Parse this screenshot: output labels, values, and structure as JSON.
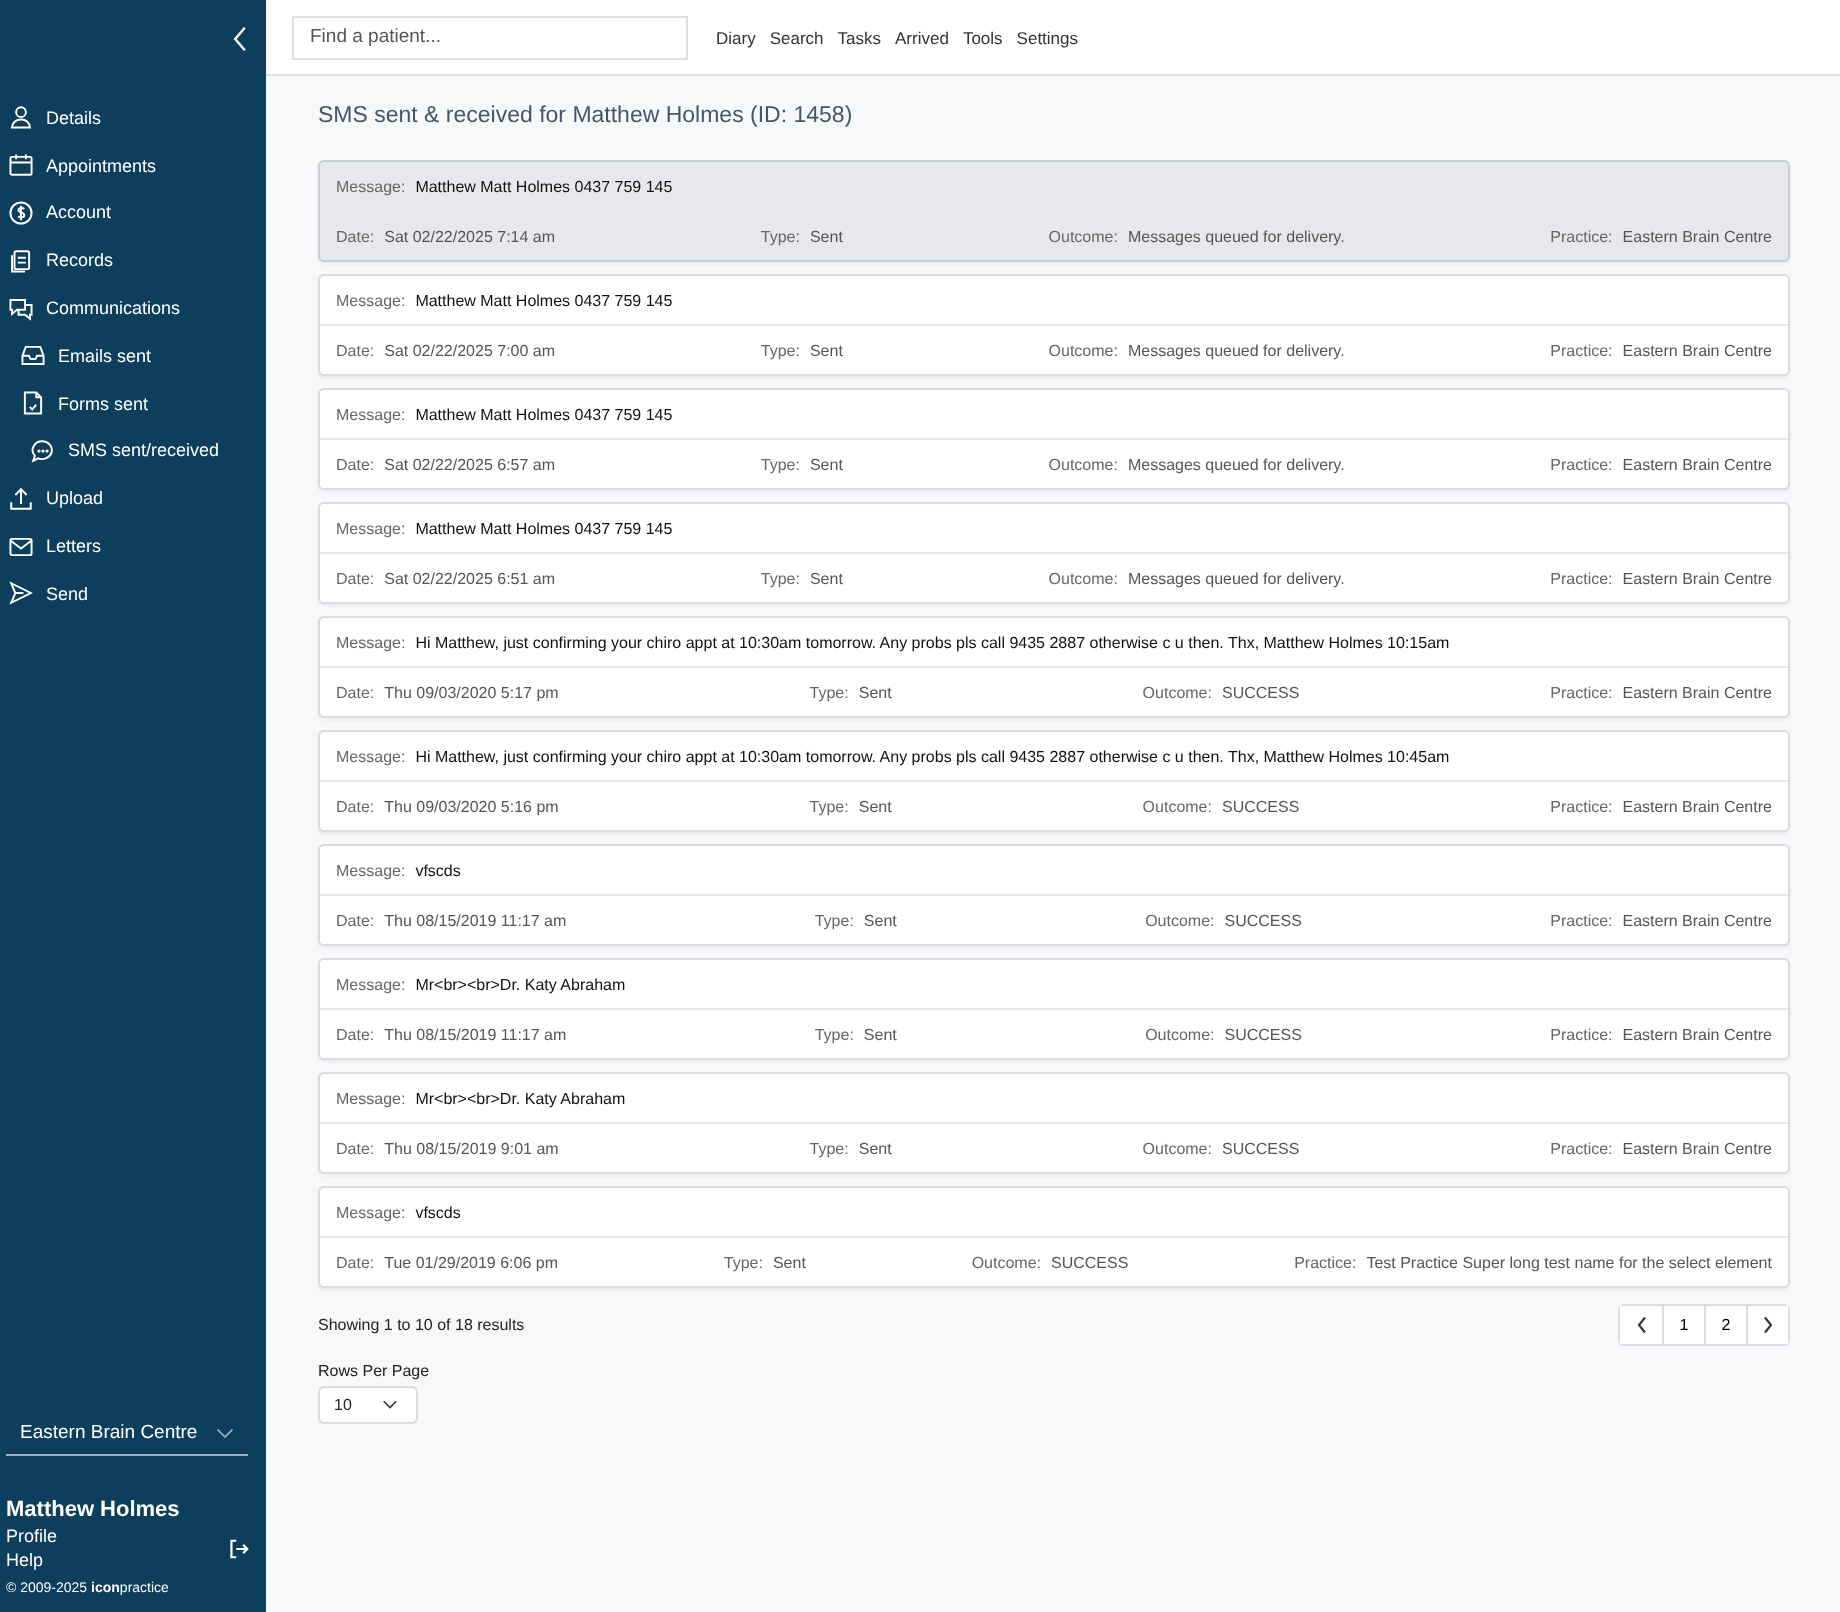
{
  "sidebar": {
    "items": [
      {
        "label": "Details"
      },
      {
        "label": "Appointments"
      },
      {
        "label": "Account"
      },
      {
        "label": "Records"
      },
      {
        "label": "Communications",
        "children": [
          {
            "label": "Emails sent"
          },
          {
            "label": "Forms sent"
          },
          {
            "label": "SMS sent/received"
          }
        ]
      },
      {
        "label": "Upload"
      },
      {
        "label": "Letters"
      },
      {
        "label": "Send"
      }
    ],
    "practice_select": {
      "value": "Eastern Brain Centre"
    },
    "user": {
      "name": "Matthew Holmes",
      "links": [
        "Profile",
        "Help"
      ]
    },
    "copyright": "© 2009-2025 **icon**practice"
  },
  "topbar": {
    "search": {
      "placeholder": "Find a patient..."
    },
    "menu": [
      "Diary",
      "Search",
      "Tasks",
      "Arrived",
      "Tools",
      "Settings"
    ]
  },
  "page_title": "SMS sent & received for Matthew Holmes (ID: 1458)",
  "messages": [
    {
      "selected": true,
      "message": {
        "label": "Message:",
        "value": "Matthew Matt Holmes 0437 759 145"
      },
      "fields": [
        {
          "label": "Date:",
          "value": "Sat 02/22/2025 7:14 am"
        },
        {
          "label": "Type:",
          "value": "Sent"
        },
        {
          "label": "Outcome:",
          "value": "Messages queued for delivery."
        },
        {
          "label": "Practice:",
          "value": "Eastern Brain Centre"
        }
      ]
    },
    {
      "selected": false,
      "message": {
        "label": "Message:",
        "value": "Matthew Matt Holmes 0437 759 145"
      },
      "fields": [
        {
          "label": "Date:",
          "value": "Sat 02/22/2025 7:00 am"
        },
        {
          "label": "Type:",
          "value": "Sent"
        },
        {
          "label": "Outcome:",
          "value": "Messages queued for delivery."
        },
        {
          "label": "Practice:",
          "value": "Eastern Brain Centre"
        }
      ]
    },
    {
      "selected": false,
      "message": {
        "label": "Message:",
        "value": "Matthew Matt Holmes 0437 759 145"
      },
      "fields": [
        {
          "label": "Date:",
          "value": "Sat 02/22/2025 6:57 am"
        },
        {
          "label": "Type:",
          "value": "Sent"
        },
        {
          "label": "Outcome:",
          "value": "Messages queued for delivery."
        },
        {
          "label": "Practice:",
          "value": "Eastern Brain Centre"
        }
      ]
    },
    {
      "selected": false,
      "message": {
        "label": "Message:",
        "value": "Matthew Matt Holmes 0437 759 145"
      },
      "fields": [
        {
          "label": "Date:",
          "value": "Sat 02/22/2025 6:51 am"
        },
        {
          "label": "Type:",
          "value": "Sent"
        },
        {
          "label": "Outcome:",
          "value": "Messages queued for delivery."
        },
        {
          "label": "Practice:",
          "value": "Eastern Brain Centre"
        }
      ]
    },
    {
      "selected": false,
      "message": {
        "label": "Message:",
        "value": "Hi Matthew, just confirming your chiro appt at 10:30am tomorrow. Any probs pls call 9435 2887 otherwise c u then. Thx, Matthew Holmes 10:15am"
      },
      "fields": [
        {
          "label": "Date:",
          "value": "Thu 09/03/2020 5:17 pm"
        },
        {
          "label": "Type:",
          "value": "Sent"
        },
        {
          "label": "Outcome:",
          "value": "SUCCESS"
        },
        {
          "label": "Practice:",
          "value": "Eastern Brain Centre"
        }
      ]
    },
    {
      "selected": false,
      "message": {
        "label": "Message:",
        "value": "Hi Matthew, just confirming your chiro appt at 10:30am tomorrow. Any probs pls call 9435 2887 otherwise c u then. Thx, Matthew Holmes 10:45am"
      },
      "fields": [
        {
          "label": "Date:",
          "value": "Thu 09/03/2020 5:16 pm"
        },
        {
          "label": "Type:",
          "value": "Sent"
        },
        {
          "label": "Outcome:",
          "value": "SUCCESS"
        },
        {
          "label": "Practice:",
          "value": "Eastern Brain Centre"
        }
      ]
    },
    {
      "selected": false,
      "message": {
        "label": "Message:",
        "value": "vfscds"
      },
      "fields": [
        {
          "label": "Date:",
          "value": "Thu 08/15/2019 11:17 am"
        },
        {
          "label": "Type:",
          "value": "Sent"
        },
        {
          "label": "Outcome:",
          "value": "SUCCESS"
        },
        {
          "label": "Practice:",
          "value": "Eastern Brain Centre"
        }
      ]
    },
    {
      "selected": false,
      "message": {
        "label": "Message:",
        "value": "Mr<br><br>Dr. Katy Abraham"
      },
      "fields": [
        {
          "label": "Date:",
          "value": "Thu 08/15/2019 11:17 am"
        },
        {
          "label": "Type:",
          "value": "Sent"
        },
        {
          "label": "Outcome:",
          "value": "SUCCESS"
        },
        {
          "label": "Practice:",
          "value": "Eastern Brain Centre"
        }
      ]
    },
    {
      "selected": false,
      "message": {
        "label": "Message:",
        "value": "Mr<br><br>Dr. Katy Abraham"
      },
      "fields": [
        {
          "label": "Date:",
          "value": "Thu 08/15/2019 9:01 am"
        },
        {
          "label": "Type:",
          "value": "Sent"
        },
        {
          "label": "Outcome:",
          "value": "SUCCESS"
        },
        {
          "label": "Practice:",
          "value": "Eastern Brain Centre"
        }
      ]
    },
    {
      "selected": false,
      "message": {
        "label": "Message:",
        "value": "vfscds"
      },
      "fields": [
        {
          "label": "Date:",
          "value": "Tue 01/29/2019 6:06 pm"
        },
        {
          "label": "Type:",
          "value": "Sent"
        },
        {
          "label": "Outcome:",
          "value": "SUCCESS"
        },
        {
          "label": "Practice:",
          "value": "Test Practice Super long test name for the select element"
        }
      ]
    }
  ],
  "pagination": {
    "summary": "Showing 1 to 10 of 18 results",
    "pages": [
      "1",
      "2"
    ]
  },
  "rows_per_page": {
    "label": "Rows Per Page",
    "value": "10"
  }
}
